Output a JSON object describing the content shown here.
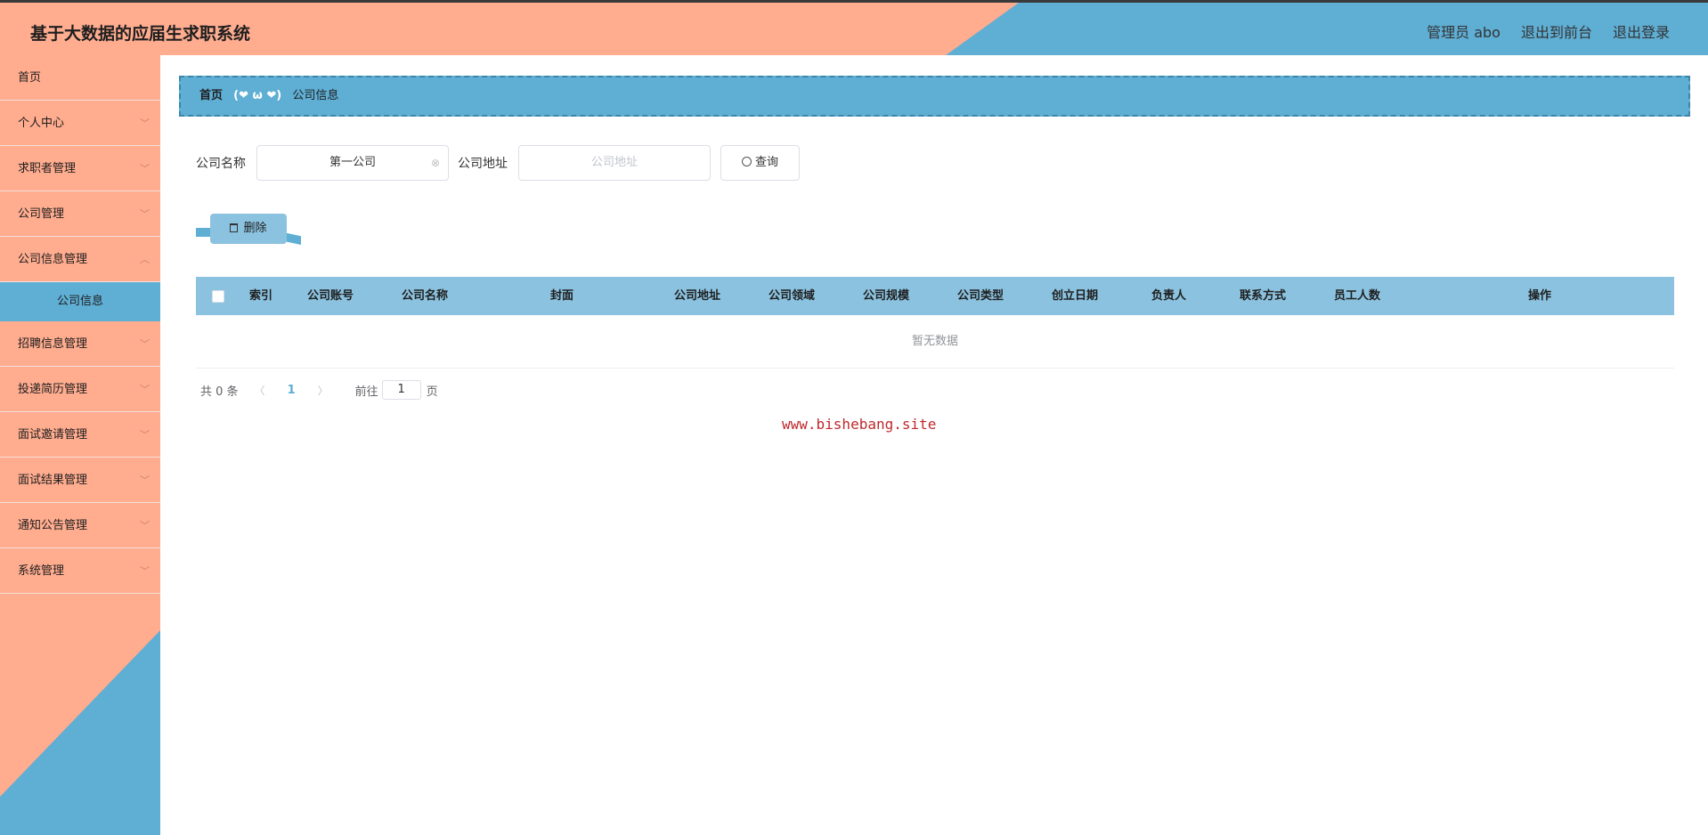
{
  "header": {
    "title": "基于大数据的应届生求职系统",
    "user": "管理员 abo",
    "front_link": "退出到前台",
    "logout": "退出登录"
  },
  "sidebar": {
    "items": [
      {
        "label": "首页",
        "has_chevron": false
      },
      {
        "label": "个人中心",
        "has_chevron": true
      },
      {
        "label": "求职者管理",
        "has_chevron": true
      },
      {
        "label": "公司管理",
        "has_chevron": true
      },
      {
        "label": "公司信息管理",
        "has_chevron": true
      },
      {
        "label": "公司信息",
        "active": true
      },
      {
        "label": "招聘信息管理",
        "has_chevron": true
      },
      {
        "label": "投递简历管理",
        "has_chevron": true
      },
      {
        "label": "面试邀请管理",
        "has_chevron": true
      },
      {
        "label": "面试结果管理",
        "has_chevron": true
      },
      {
        "label": "通知公告管理",
        "has_chevron": true
      },
      {
        "label": "系统管理",
        "has_chevron": true
      }
    ]
  },
  "breadcrumb": {
    "home": "首页",
    "separator": "(❤ ω ❤)",
    "current": "公司信息"
  },
  "search": {
    "company_name_label": "公司名称",
    "company_name_value": "第一公司",
    "company_address_label": "公司地址",
    "company_address_placeholder": "公司地址",
    "query_button": "查询"
  },
  "actions": {
    "delete_button": "删除"
  },
  "table": {
    "columns": [
      "索引",
      "公司账号",
      "公司名称",
      "封面",
      "公司地址",
      "公司领域",
      "公司规模",
      "公司类型",
      "创立日期",
      "负责人",
      "联系方式",
      "员工人数",
      "操作"
    ],
    "empty_text": "暂无数据"
  },
  "pagination": {
    "total": "共 0 条",
    "current_page": "1",
    "goto_label": "前往",
    "goto_value": "1",
    "page_suffix": "页"
  },
  "watermark": "www.bishebang.site",
  "colors": {
    "salmon": "#ffac8f",
    "blue": "#5faed4",
    "light_blue": "#8bc2df"
  }
}
